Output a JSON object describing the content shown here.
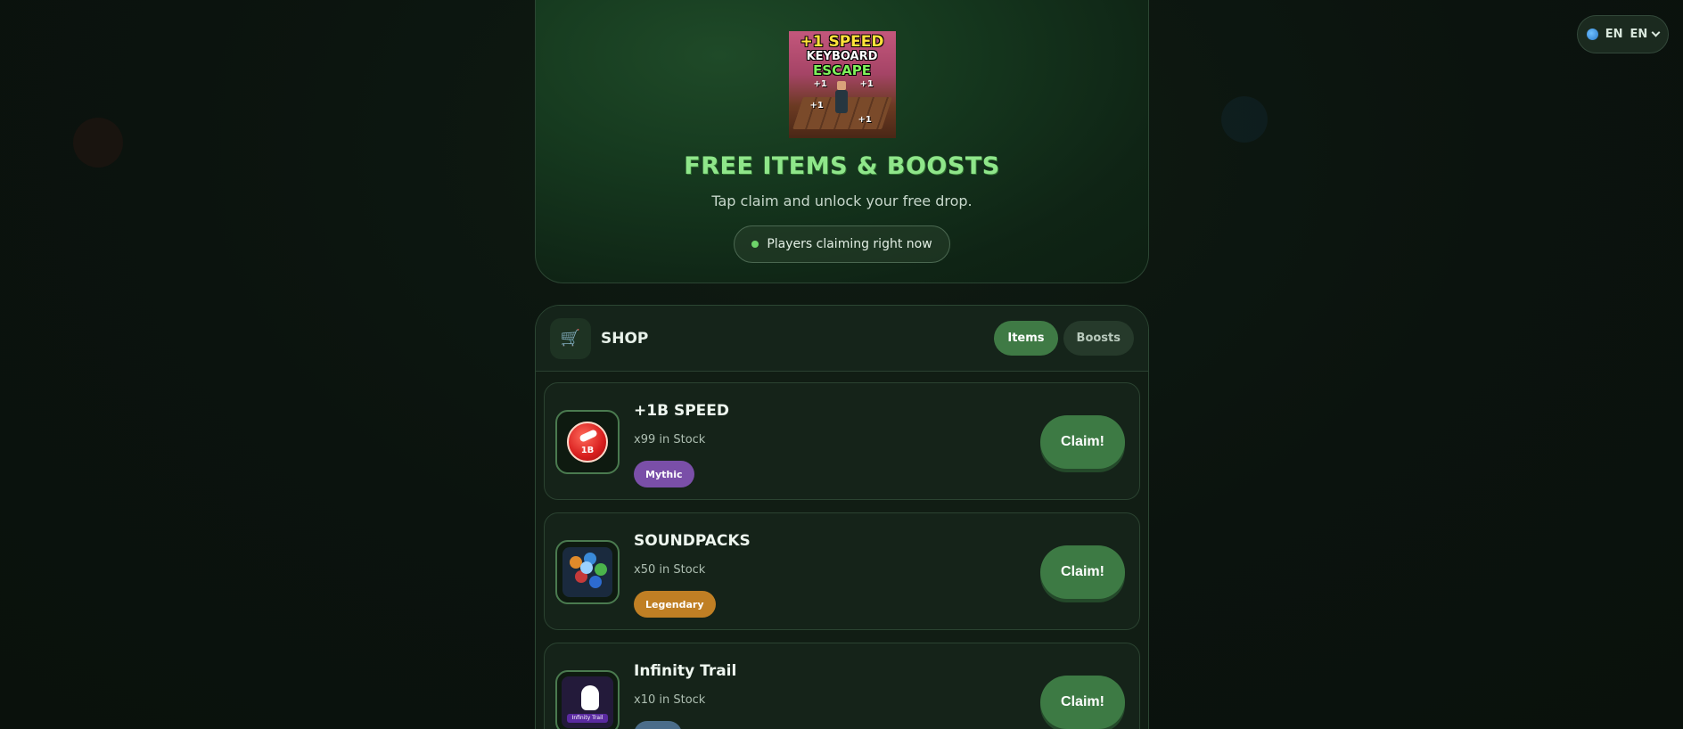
{
  "language": {
    "code": "EN",
    "selected": "EN"
  },
  "hero": {
    "thumbnail_lines": [
      "+1 SPEED",
      "KEYBOARD",
      "ESCAPE"
    ],
    "thumbnail_plus_marks": [
      "+1",
      "+1",
      "+1",
      "+1"
    ],
    "title": "FREE ITEMS & BOOSTS",
    "subtitle": "Tap claim and unlock your free drop.",
    "status_pill": "Players claiming right now"
  },
  "shop": {
    "title": "SHOP",
    "cart_icon": "cart-icon",
    "tabs": [
      {
        "label": "Items",
        "active": true
      },
      {
        "label": "Boosts",
        "active": false
      }
    ],
    "items": [
      {
        "name": "+1B SPEED",
        "stock": "x99 in Stock",
        "rarity": "Mythic",
        "rarity_color": "#7a4fa8",
        "icon": "speed-1b-icon",
        "icon_text": "1B",
        "claim_label": "Claim!"
      },
      {
        "name": "SOUNDPACKS",
        "stock": "x50 in Stock",
        "rarity": "Legendary",
        "rarity_color": "#c07f24",
        "icon": "soundpacks-icon",
        "claim_label": "Claim!"
      },
      {
        "name": "Infinity Trail",
        "stock": "x10 in Stock",
        "rarity": "",
        "rarity_color": "#4b6d8a",
        "icon": "infinity-trail-icon",
        "icon_text": "Infinity Trail",
        "claim_label": "Claim!"
      }
    ]
  },
  "colors": {
    "accent": "#3d7a44",
    "title_green": "#8fe68a",
    "background": "#0b130e"
  }
}
